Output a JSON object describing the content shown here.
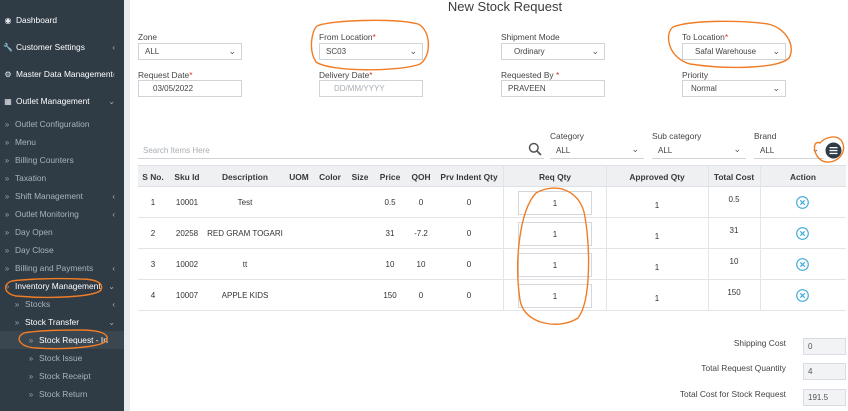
{
  "sidebar": {
    "items": [
      {
        "label": "Dashboard",
        "icon": "dashboard-icon"
      },
      {
        "label": "Customer Settings",
        "icon": "wrench-icon"
      },
      {
        "label": "Master Data Management",
        "icon": "gear-icon"
      },
      {
        "label": "Outlet Management",
        "icon": "store-icon"
      },
      {
        "label": "Outlet Configuration"
      },
      {
        "label": "Menu"
      },
      {
        "label": "Billing Counters"
      },
      {
        "label": "Taxation"
      },
      {
        "label": "Shift Management"
      },
      {
        "label": "Outlet Monitoring"
      },
      {
        "label": "Day Open"
      },
      {
        "label": "Day Close"
      },
      {
        "label": "Billing and Payments"
      },
      {
        "label": "Inventory Management"
      },
      {
        "label": "Stocks"
      },
      {
        "label": "Stock Transfer"
      },
      {
        "label": "Stock Request - In"
      },
      {
        "label": "Stock Issue"
      },
      {
        "label": "Stock Receipt"
      },
      {
        "label": "Stock Return"
      }
    ]
  },
  "page": {
    "title": "New Stock Request"
  },
  "form": {
    "zone": {
      "label": "Zone",
      "value": "ALL"
    },
    "from_location": {
      "label": "From Location",
      "value": "SC03"
    },
    "shipment_mode": {
      "label": "Shipment Mode",
      "value": "Ordinary"
    },
    "to_location": {
      "label": "To Location",
      "value": "Safal Warehouse"
    },
    "request_date": {
      "label": "Request Date",
      "value": "03/05/2022"
    },
    "delivery_date": {
      "label": "Delivery Date",
      "placeholder": "DD/MM/YYYY"
    },
    "requested_by": {
      "label": "Requested By",
      "value": "PRAVEEN"
    },
    "priority": {
      "label": "Priority",
      "value": "Normal"
    },
    "required_mark": "*"
  },
  "filters": {
    "search_placeholder": "Search Items Here",
    "category": {
      "label": "Category",
      "value": "ALL"
    },
    "sub_category": {
      "label": "Sub category",
      "value": "ALL"
    },
    "brand": {
      "label": "Brand",
      "value": "ALL"
    }
  },
  "table": {
    "headers": [
      "S No.",
      "Sku Id",
      "Description",
      "UOM",
      "Color",
      "Size",
      "Price",
      "QOH",
      "Prv Indent Qty",
      "Req Qty",
      "Approved Qty",
      "Total Cost",
      "Action"
    ],
    "rows": [
      {
        "sno": "1",
        "sku": "10001",
        "desc": "Test",
        "uom": "",
        "color": "",
        "size": "",
        "price": "0.5",
        "qoh": "0",
        "prv": "0",
        "req": "1",
        "approved": "1",
        "total": "0.5"
      },
      {
        "sno": "2",
        "sku": "20258",
        "desc": "RED GRAM TOGARI",
        "uom": "",
        "color": "",
        "size": "",
        "price": "31",
        "qoh": "-7.2",
        "prv": "0",
        "req": "1",
        "approved": "1",
        "total": "31"
      },
      {
        "sno": "3",
        "sku": "10002",
        "desc": "tt",
        "uom": "",
        "color": "",
        "size": "",
        "price": "10",
        "qoh": "10",
        "prv": "0",
        "req": "1",
        "approved": "1",
        "total": "10"
      },
      {
        "sno": "4",
        "sku": "10007",
        "desc": "APPLE KIDS",
        "uom": "",
        "color": "",
        "size": "",
        "price": "150",
        "qoh": "0",
        "prv": "0",
        "req": "1",
        "approved": "1",
        "total": "150"
      }
    ]
  },
  "totals": {
    "shipping_cost": {
      "label": "Shipping Cost",
      "value": "0"
    },
    "total_request_qty": {
      "label": "Total Request Quantity",
      "value": "4"
    },
    "total_cost": {
      "label": "Total Cost for Stock Request",
      "value": "191.5"
    }
  },
  "colors": {
    "sidebar_bg": "#2f3b45",
    "annotation": "#f07d26",
    "action_icon": "#39a8d8",
    "required": "#e03030"
  }
}
